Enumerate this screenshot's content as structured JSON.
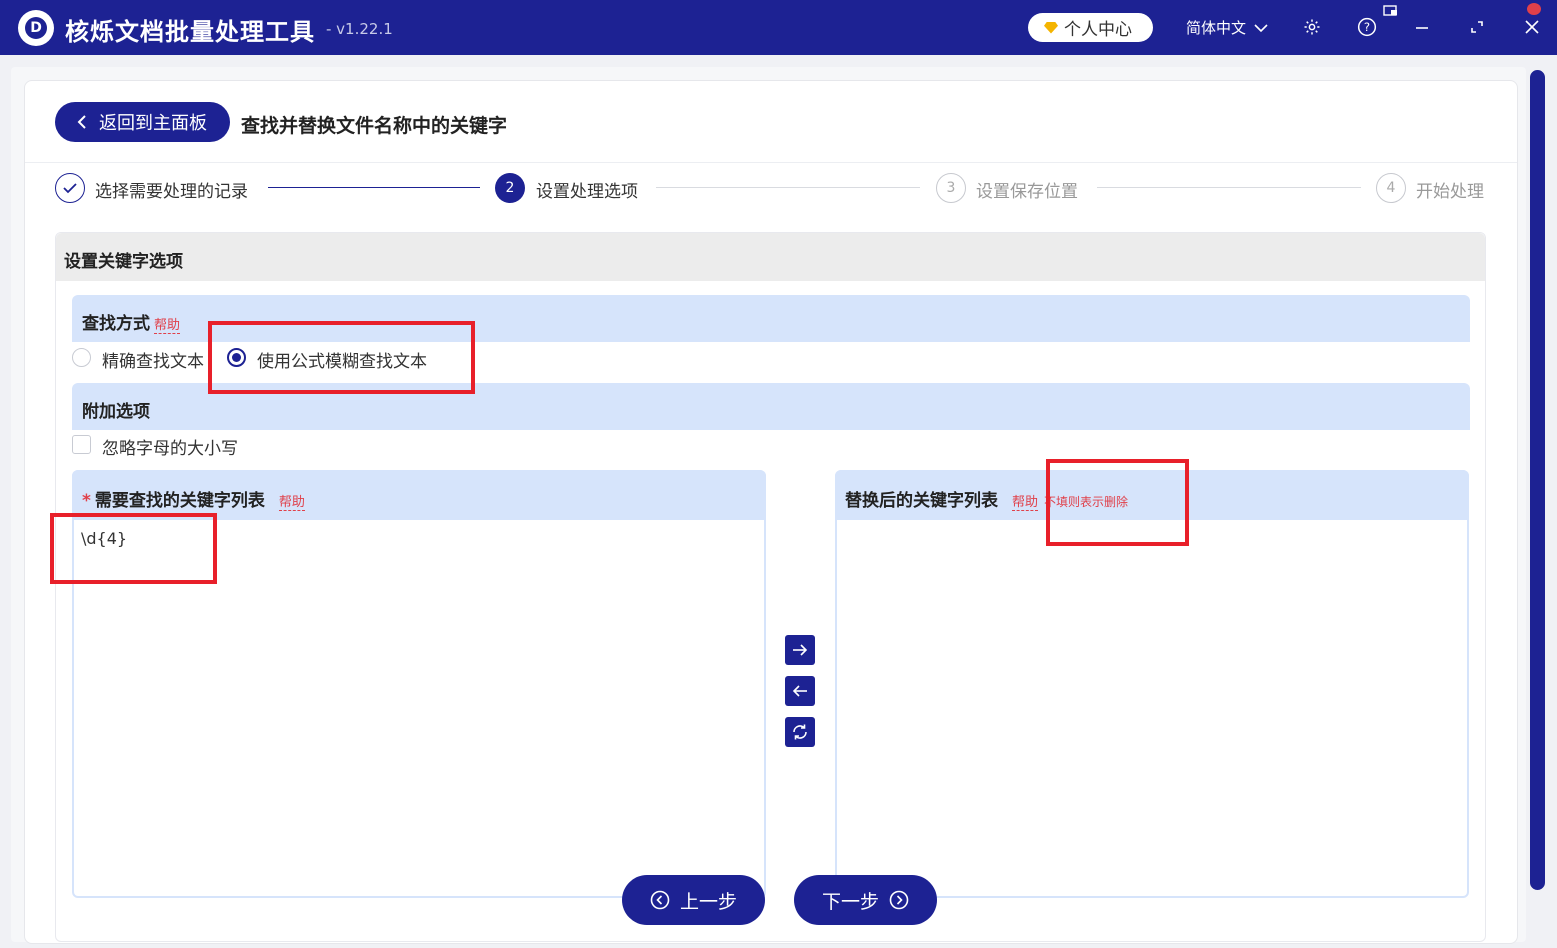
{
  "titlebar": {
    "app_title": "核烁文档批量处理工具",
    "version": "- v1.22.1",
    "user_center": "个人中心",
    "language": "简体中文",
    "brand_color": "#1d2293"
  },
  "header": {
    "back_label": "返回到主面板",
    "page_title": "查找并替换文件名称中的关键字"
  },
  "steps": [
    {
      "number": "",
      "label": "选择需要处理的记录",
      "state": "done"
    },
    {
      "number": "2",
      "label": "设置处理选项",
      "state": "active"
    },
    {
      "number": "3",
      "label": "设置保存位置",
      "state": "pending"
    },
    {
      "number": "4",
      "label": "开始处理",
      "state": "pending"
    }
  ],
  "section": {
    "title": "设置关键字选项"
  },
  "search_mode": {
    "label": "查找方式",
    "help": "帮助",
    "options": [
      {
        "label": "精确查找文本",
        "checked": false
      },
      {
        "label": "使用公式模糊查找文本",
        "checked": true
      }
    ]
  },
  "extra_options": {
    "label": "附加选项",
    "ignore_case": {
      "label": "忽略字母的大小写",
      "checked": false
    }
  },
  "find_list": {
    "required_mark": "*",
    "label": "需要查找的关键字列表",
    "help": "帮助",
    "value": "\\d{4}"
  },
  "replace_list": {
    "label": "替换后的关键字列表",
    "help": "帮助",
    "note": "不填则表示删除",
    "value": ""
  },
  "nav": {
    "prev_label": "上一步",
    "next_label": "下一步"
  }
}
